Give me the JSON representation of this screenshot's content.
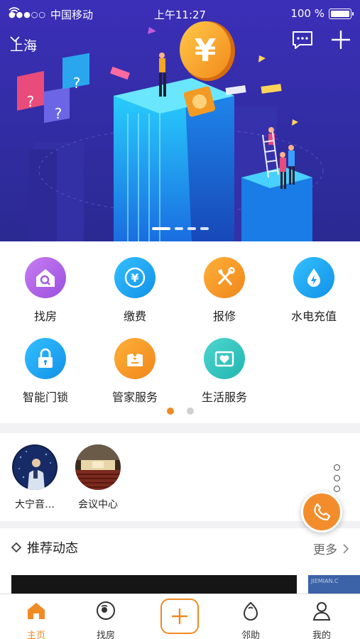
{
  "status_bar": {
    "signal": "●●●○○",
    "carrier": "中国移动",
    "time": "上午11:27",
    "battery": "100 %"
  },
  "top_nav": {
    "city": "上海"
  },
  "banner": {
    "slides": 4,
    "active_slide": 1
  },
  "services": {
    "items": [
      {
        "label": "找房",
        "icon": "house-search-icon",
        "color": "#b469e6"
      },
      {
        "label": "缴费",
        "icon": "yen-icon",
        "color": "#1fa8f0"
      },
      {
        "label": "报修",
        "icon": "tools-icon",
        "color": "#f39a24"
      },
      {
        "label": "水电充值",
        "icon": "water-bolt-icon",
        "color": "#1fa8f0"
      },
      {
        "label": "智能门锁",
        "icon": "lock-icon",
        "color": "#1fa8f0"
      },
      {
        "label": "管家服务",
        "icon": "butler-icon",
        "color": "#f39a24"
      },
      {
        "label": "生活服务",
        "icon": "heart-box-icon",
        "color": "#33c6c2"
      }
    ],
    "pages": 2,
    "active_page": 1
  },
  "venues": {
    "items": [
      {
        "name": "大宁音…"
      },
      {
        "name": "会议中心"
      }
    ]
  },
  "recommend": {
    "title": "推荐动态",
    "more": "更多",
    "thumb_b_text": "JIEMIAN.C"
  },
  "tabbar": {
    "items": [
      {
        "label": "主页",
        "icon": "home-icon",
        "active": true
      },
      {
        "label": "找房",
        "icon": "find-room-icon",
        "active": false
      },
      {
        "label": "",
        "icon": "plus-icon",
        "active": false
      },
      {
        "label": "邻助",
        "icon": "neighbor-help-icon",
        "active": false
      },
      {
        "label": "我的",
        "icon": "profile-icon",
        "active": false
      }
    ]
  },
  "colors": {
    "accent": "#f08a24",
    "hero_bg": "#2f2aa0"
  }
}
